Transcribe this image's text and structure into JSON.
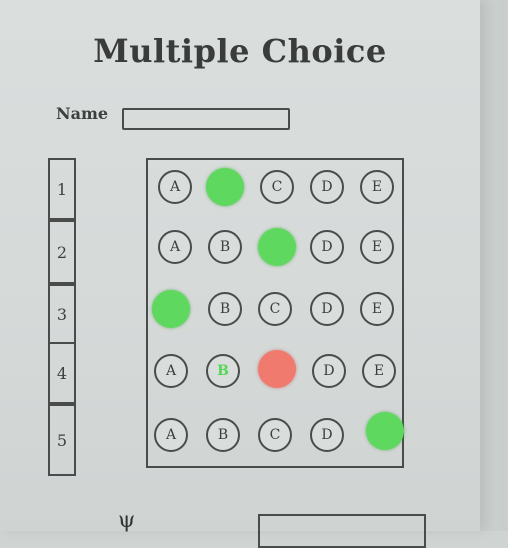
{
  "sheet": {
    "title": "Multiple Choice",
    "name_label": "Name",
    "name_value": "",
    "question_numbers": [
      "1",
      "2",
      "3",
      "4",
      "5"
    ],
    "bottom_mark": "ψ"
  },
  "questions": [
    {
      "number": "1",
      "options": [
        "A",
        "B",
        "C",
        "D",
        "E"
      ],
      "filled": "B",
      "status": "correct"
    },
    {
      "number": "2",
      "options": [
        "A",
        "B",
        "C",
        "D",
        "E"
      ],
      "filled": "C",
      "status": "correct"
    },
    {
      "number": "3",
      "options": [
        "A",
        "B",
        "C",
        "D",
        "E"
      ],
      "filled": "A",
      "status": "correct"
    },
    {
      "number": "4",
      "options": [
        "A",
        "B",
        "C",
        "D",
        "E"
      ],
      "filled": "C",
      "correct_answer": "B",
      "status": "incorrect"
    },
    {
      "number": "5",
      "options": [
        "A",
        "B",
        "C",
        "D",
        "E"
      ],
      "filled": "E",
      "status": "correct"
    }
  ],
  "colors": {
    "correct": "#5ed85e",
    "incorrect": "#f07a6e",
    "ink": "#4a4c4c",
    "paper": "#d7dbda"
  }
}
